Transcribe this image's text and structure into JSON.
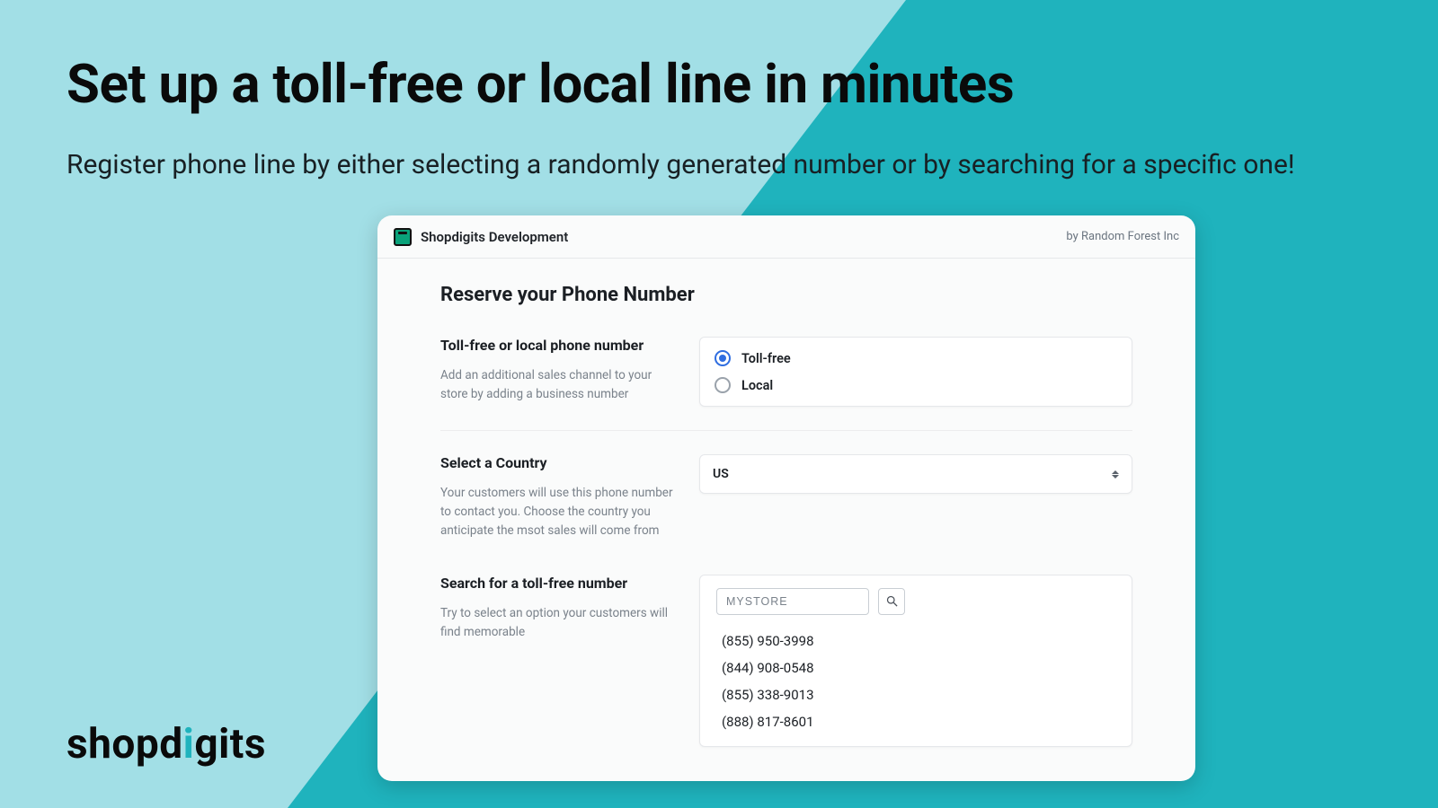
{
  "hero": {
    "title": "Set up a toll-free or local line in minutes",
    "subtitle": "Register phone line by either selecting a randomly generated number or by searching for a specific one!"
  },
  "brand": {
    "pre": "shopd",
    "accent": "i",
    "post": "gits"
  },
  "panel": {
    "app_name": "Shopdigits Development",
    "byline": "by Random Forest Inc",
    "page_title": "Reserve your Phone Number",
    "section_type": {
      "label": "Toll-free or local phone number",
      "help": "Add an additional sales channel to your store by adding a business number",
      "options": [
        {
          "label": "Toll-free",
          "selected": true
        },
        {
          "label": "Local",
          "selected": false
        }
      ]
    },
    "section_country": {
      "label": "Select a Country",
      "help": "Your customers will use this phone number to contact you. Choose the country you anticipate the msot sales will come from",
      "value": "US"
    },
    "section_search": {
      "label": "Search for a toll-free number",
      "help": "Try to select an option your customers will find memorable",
      "input_value": "MYSTORE",
      "results": [
        "(855) 950-3998",
        "(844) 908-0548",
        "(855) 338-9013",
        "(888) 817-8601"
      ]
    }
  }
}
